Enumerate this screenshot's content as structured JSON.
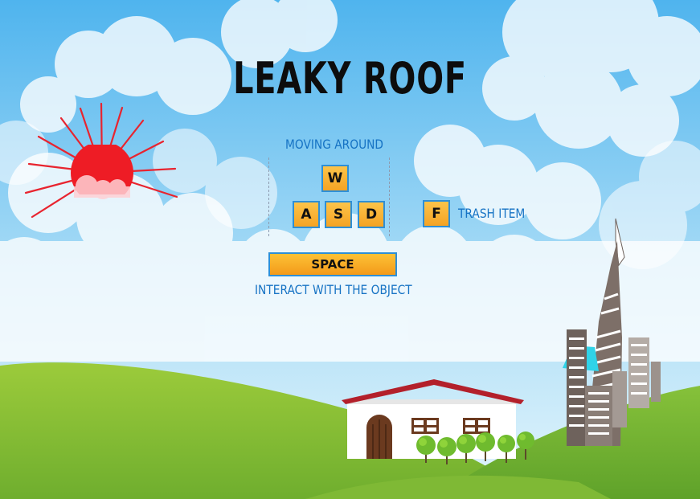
{
  "game": {
    "title": "LEAKY ROOF"
  },
  "controls": {
    "moving": {
      "label": "MOVING AROUND",
      "keys": {
        "up": "W",
        "left": "A",
        "down": "S",
        "right": "D"
      }
    },
    "trash": {
      "key": "F",
      "label": "TRASH ITEM"
    },
    "interact": {
      "key": "SPACE",
      "label": "INTERACT WITH THE OBJECT"
    }
  },
  "colors": {
    "sky_top": "#5fbdf0",
    "sky_bottom": "#d7f0fb",
    "grass": "#8cc63f",
    "sun": "#ee1c25",
    "roof": "#b3202b",
    "key_fill": "#f9b233",
    "key_border": "#2e8fd6",
    "label_text": "#1673c4"
  }
}
